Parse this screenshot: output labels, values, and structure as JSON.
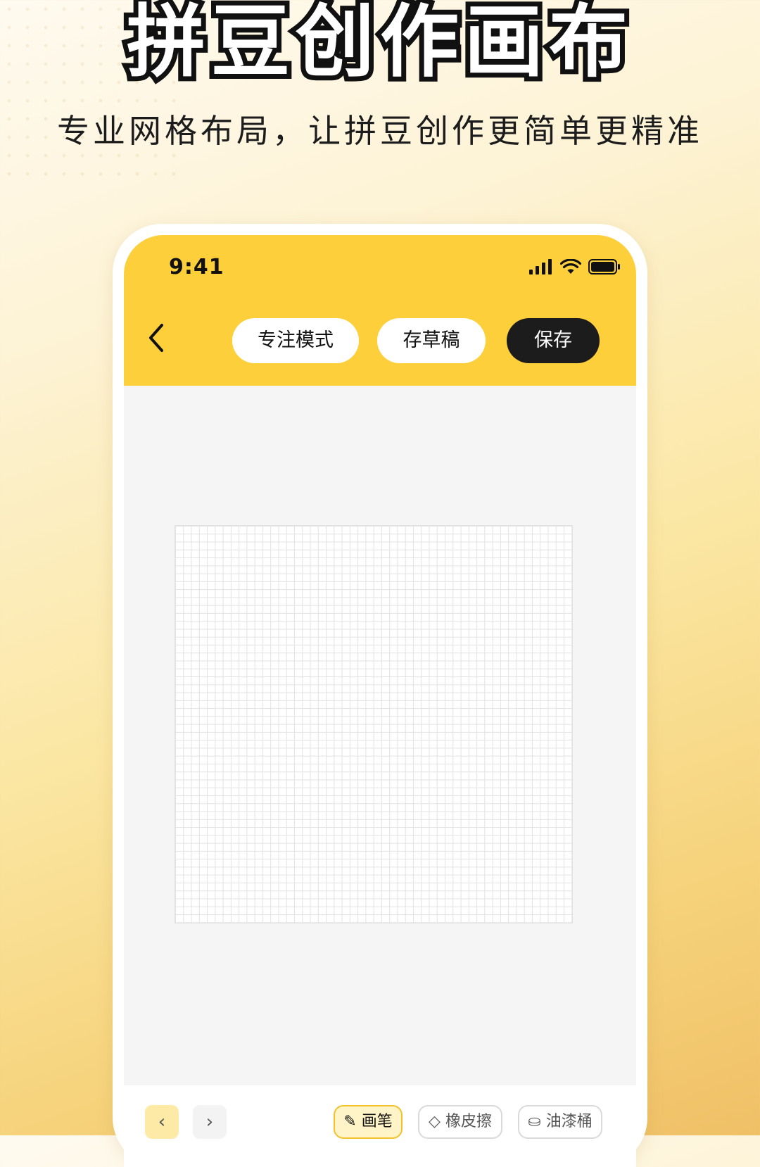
{
  "promo": {
    "headline": "拼豆创作画布",
    "subtitle": "专业网格布局，让拼豆创作更简单更精准"
  },
  "status_bar": {
    "time": "9:41"
  },
  "toolbar": {
    "focus_label": "专注模式",
    "draft_label": "存草稿",
    "save_label": "保存"
  },
  "canvas": {
    "grid_cells_per_side": 50
  },
  "bottom_tools": {
    "pen_label": "画笔",
    "eraser_label": "橡皮擦",
    "bucket_label": "油漆桶"
  },
  "colors": {
    "accent_yellow": "#fdd03b",
    "dark_button": "#1c1c1c",
    "canvas_bg": "#f5f5f5"
  }
}
